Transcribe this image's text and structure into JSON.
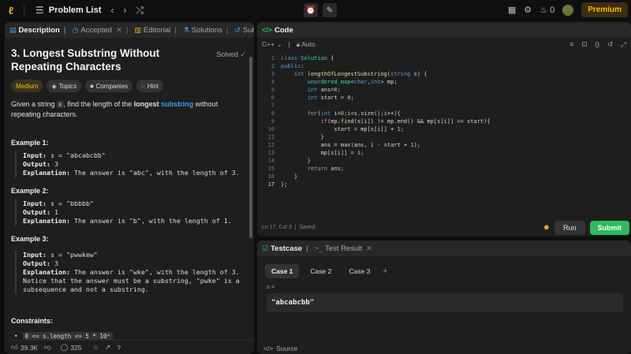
{
  "topbar": {
    "problem_list": "Problem List",
    "streak_count": "0",
    "premium": "Premium"
  },
  "desc_panel": {
    "tabs": [
      "Description",
      "Accepted",
      "Editorial",
      "Solutions",
      "Submissions"
    ],
    "title": "3. Longest Substring Without Repeating Characters",
    "solved": "Solved",
    "tags": [
      "Medium",
      "Topics",
      "Companies",
      "Hint"
    ],
    "statement": {
      "p1": "Given a string ",
      "code": "s",
      "p2": ", find the length of the ",
      "bold": "longest",
      "link": "substring",
      "p3": " without repeating characters."
    },
    "examples": [
      {
        "title": "Example 1:",
        "input": "s = \"abcabcbb\"",
        "output": "3",
        "explanation": "The answer is \"abc\", with the length of 3."
      },
      {
        "title": "Example 2:",
        "input": "s = \"bbbbb\"",
        "output": "1",
        "explanation": "The answer is \"b\", with the length of 1."
      },
      {
        "title": "Example 3:",
        "input": "s = \"pwwkew\"",
        "output": "3",
        "explanation": "The answer is \"wke\", with the length of 3.",
        "note1": "Notice that the answer must be a substring, \"pwke\" is a",
        "note2": "subsequence and not a substring."
      }
    ],
    "labels": {
      "input": "Input:",
      "output": "Output:",
      "explanation": "Explanation:"
    },
    "constraints_title": "Constraints:",
    "constraint": "0 <= s.length <= 5 * 10⁴",
    "footer": {
      "likes": "39.3K",
      "comments": "325"
    }
  },
  "code_panel": {
    "title": "Code",
    "language": "C++",
    "auto": "Auto",
    "status": "Ln 17, Col 3",
    "saved": "Saved",
    "run": "Run",
    "submit": "Submit"
  },
  "test_panel": {
    "tab_testcase": "Testcase",
    "tab_result": "Test Result",
    "cases": [
      "Case 1",
      "Case 2",
      "Case 3"
    ],
    "var_name": "s =",
    "var_value": "\"abcabcbb\"",
    "source": "Source"
  }
}
